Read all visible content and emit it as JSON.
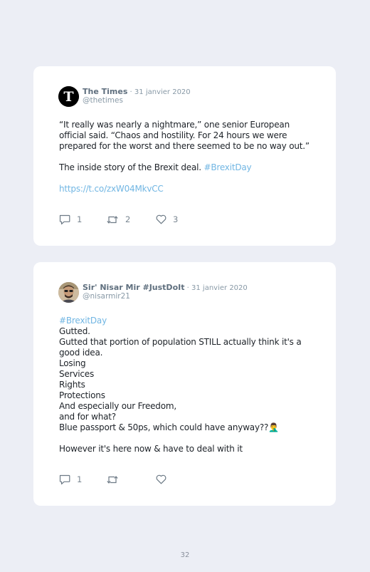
{
  "page_number": "32",
  "tweets": [
    {
      "author": {
        "name": "The Times",
        "handle": "@thetimes",
        "avatar_letter": "T"
      },
      "separator": " · ",
      "date": "31 janvier 2020",
      "text": {
        "lines": [
          "“It really was nearly a nightmare,” one senior European",
          "official said. “Chaos and hostility. For 24 hours we were",
          "prepared for the worst and there seemed to be no way out.”"
        ],
        "line2": "The inside story of the Brexit deal. ",
        "hashtag": "#BrexitDay",
        "link": "https://t.co/zxW04MkvCC"
      },
      "stats": {
        "replies": "1",
        "retweets": "2",
        "likes": "3"
      }
    },
    {
      "author": {
        "name": "Sir' Nisar Mir #JustDoIt",
        "handle": "@nisarmir21"
      },
      "separator": " · ",
      "date": "31 janvier 2020",
      "text": {
        "hashtag": "#BrexitDay",
        "lines": [
          "Gutted.",
          "Gutted that portion of population STILL actually think it's a",
          "good idea.",
          "Losing",
          "Services",
          "Rights",
          "Protections",
          "And especially our Freedom,",
          "and for what?",
          "Blue passport & 50ps, which could have anyway??"
        ],
        "emoji": "🤦‍♂️",
        "last_line": "However it's here now & have to deal with it"
      },
      "stats": {
        "replies": "1",
        "retweets": "",
        "likes": ""
      }
    }
  ],
  "icons": {
    "reply": "reply-icon",
    "retweet": "retweet-icon",
    "like": "heart-icon"
  },
  "colors": {
    "background": "#eceef5",
    "card": "#ffffff",
    "link": "#71b6e3",
    "text": "#1d2228",
    "muted": "#8899a6"
  }
}
